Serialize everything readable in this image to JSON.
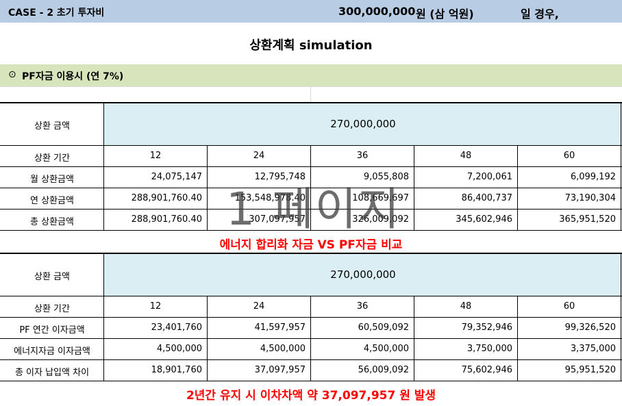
{
  "header": {
    "case_label": "CASE - 2 초기 투자비",
    "amount": "300,000,000",
    "unit": "원 (삼 억원)",
    "suffix": "일 경우,"
  },
  "title": "상환계획 simulation",
  "section": {
    "marker": "⊙",
    "label": "PF자금 이용시 (연 7%)"
  },
  "table1": {
    "amount_label": "상환 금액",
    "amount_value": "270,000,000",
    "period_label": "상환 기간",
    "periods": [
      "12",
      "24",
      "36",
      "48",
      "60"
    ],
    "rows": [
      {
        "label": "월 상환금액",
        "values": [
          "24,075,147",
          "12,795,748",
          "9,055,808",
          "7,200,061",
          "6,099,192"
        ]
      },
      {
        "label": "연 상환금액",
        "values": [
          "288,901,760.40",
          "153,548,978.40",
          "108,669,697",
          "86,400,737",
          "73,190,304"
        ]
      },
      {
        "label": "총 상환금액",
        "values": [
          "288,901,760.40",
          "307,097,957",
          "326,009,092",
          "345,602,946",
          "365,951,520"
        ]
      }
    ]
  },
  "comparison_title": "에너지 합리화 자금 VS PF자금 비교",
  "table2": {
    "amount_label": "상환 금액",
    "amount_value": "270,000,000",
    "period_label": "상환 기간",
    "periods": [
      "12",
      "24",
      "36",
      "48",
      "60"
    ],
    "rows": [
      {
        "label": "PF 연간 이자금액",
        "values": [
          "23,401,760",
          "41,597,957",
          "60,509,092",
          "79,352,946",
          "99,326,520"
        ]
      },
      {
        "label": "에너지자금 이자금액",
        "values": [
          "4,500,000",
          "4,500,000",
          "4,500,000",
          "3,750,000",
          "3,375,000"
        ]
      },
      {
        "label": "총 이자 납입액 차이",
        "values": [
          "18,901,760",
          "37,097,957",
          "56,009,092",
          "75,602,946",
          "95,951,520"
        ]
      }
    ]
  },
  "footer_note": "2년간 유지 시 이차차액 약 37,097,957 원 발생",
  "watermark": "1 페이지"
}
